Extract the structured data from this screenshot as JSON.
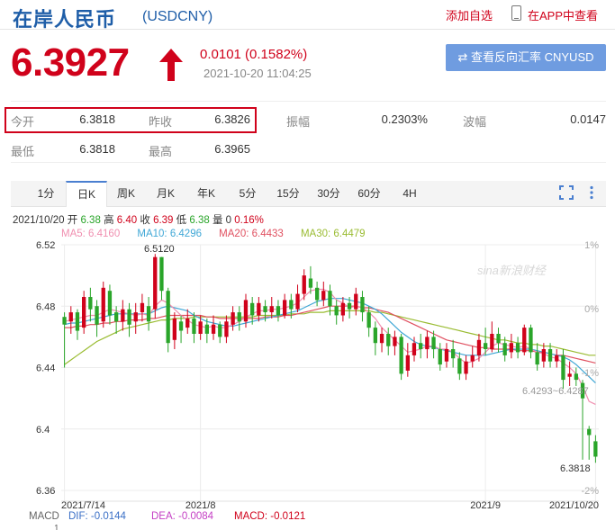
{
  "header": {
    "title": "在岸人民币",
    "code": "(USDCNY)",
    "watchlist_label": "添加自选",
    "app_label": "在APP中查看"
  },
  "quote": {
    "price": "6.3927",
    "change": "0.0101 (0.1582%)",
    "time": "2021-10-20 11:04:25",
    "reverse_button": "查看反向汇率 CNYUSD"
  },
  "stats": [
    {
      "label": "今开",
      "value": "6.3818"
    },
    {
      "label": "昨收",
      "value": "6.3826"
    },
    {
      "label": "振幅",
      "value": "0.2303%"
    },
    {
      "label": "波幅",
      "value": "0.0147"
    },
    {
      "label": "最低",
      "value": "6.3818"
    },
    {
      "label": "最高",
      "value": "6.3965"
    }
  ],
  "tabs": [
    "1分",
    "日K",
    "周K",
    "月K",
    "年K",
    "5分",
    "15分",
    "30分",
    "60分",
    "4H"
  ],
  "active_tab": "日K",
  "ohlc": {
    "date": "2021/10/20",
    "open_label": "开",
    "open": "6.38",
    "high_label": "高",
    "high": "6.40",
    "close_label": "收",
    "close": "6.39",
    "low_label": "低",
    "low": "6.38",
    "vol_label": "量",
    "vol": "0",
    "pct": "0.16%"
  },
  "ma_legend": {
    "ma5": "MA5: 6.4160",
    "ma10": "MA10: 6.4296",
    "ma20": "MA20: 6.4433",
    "ma30": "MA30: 6.4479"
  },
  "macd_legend": {
    "label": "MACD",
    "dif": "DIF: -0.0144",
    "dea": "DEA: -0.0084",
    "macd": "MACD: -0.0121",
    "axis_value": "1"
  },
  "watermark": "sina新浪财经",
  "colors": {
    "up": "#d0021b",
    "down": "#2aa52a",
    "accent": "#1f5ea8",
    "ma5": "#f08fb0",
    "ma10": "#3fa7d6",
    "ma20": "#e05060",
    "ma30": "#9abc32"
  },
  "chart_data": {
    "type": "candlestick",
    "ylim": [
      6.36,
      6.52
    ],
    "y_ticks": [
      "6.52",
      "6.48",
      "6.44",
      "6.4",
      "6.36"
    ],
    "pct_ticks": [
      "1%",
      "0%",
      "-1%",
      "-2%"
    ],
    "x_ticks": [
      "2021/7/14",
      "2021/8",
      "2021/9",
      "2021/10/20"
    ],
    "annotations": {
      "high": "6.5120",
      "range": "6.4293~6.4287",
      "last": "6.3818"
    },
    "candles": [
      [
        6.473,
        6.468,
        6.476,
        6.44
      ],
      [
        6.47,
        6.476,
        6.48,
        6.462
      ],
      [
        6.476,
        6.464,
        6.478,
        6.458
      ],
      [
        6.466,
        6.486,
        6.49,
        6.462
      ],
      [
        6.486,
        6.478,
        6.492,
        6.47
      ],
      [
        6.48,
        6.468,
        6.484,
        6.46
      ],
      [
        6.47,
        6.492,
        6.496,
        6.466
      ],
      [
        6.49,
        6.474,
        6.494,
        6.468
      ],
      [
        6.476,
        6.47,
        6.48,
        6.462
      ],
      [
        6.47,
        6.478,
        6.484,
        6.464
      ],
      [
        6.478,
        6.468,
        6.482,
        6.46
      ],
      [
        6.47,
        6.476,
        6.482,
        6.462
      ],
      [
        6.476,
        6.482,
        6.488,
        6.47
      ],
      [
        6.48,
        6.47,
        6.486,
        6.464
      ],
      [
        6.478,
        6.512,
        6.514,
        6.472
      ],
      [
        6.512,
        6.49,
        6.512,
        6.484
      ],
      [
        6.49,
        6.456,
        6.492,
        6.45
      ],
      [
        6.458,
        6.472,
        6.476,
        6.452
      ],
      [
        6.47,
        6.464,
        6.474,
        6.456
      ],
      [
        6.466,
        6.472,
        6.478,
        6.462
      ],
      [
        6.472,
        6.462,
        6.476,
        6.456
      ],
      [
        6.462,
        6.47,
        6.474,
        6.458
      ],
      [
        6.468,
        6.462,
        6.472,
        6.456
      ],
      [
        6.462,
        6.468,
        6.474,
        6.458
      ],
      [
        6.468,
        6.46,
        6.47,
        6.456
      ],
      [
        6.46,
        6.47,
        6.474,
        6.456
      ],
      [
        6.468,
        6.476,
        6.48,
        6.464
      ],
      [
        6.476,
        6.47,
        6.48,
        6.464
      ],
      [
        6.47,
        6.484,
        6.488,
        6.466
      ],
      [
        6.482,
        6.474,
        6.486,
        6.468
      ],
      [
        6.474,
        6.482,
        6.486,
        6.47
      ],
      [
        6.48,
        6.476,
        6.484,
        6.47
      ],
      [
        6.476,
        6.48,
        6.486,
        6.472
      ],
      [
        6.48,
        6.474,
        6.484,
        6.47
      ],
      [
        6.474,
        6.484,
        6.488,
        6.472
      ],
      [
        6.484,
        6.478,
        6.488,
        6.472
      ],
      [
        6.478,
        6.488,
        6.494,
        6.476
      ],
      [
        6.488,
        6.5,
        6.504,
        6.484
      ],
      [
        6.498,
        6.492,
        6.506,
        6.488
      ],
      [
        6.492,
        6.484,
        6.496,
        6.48
      ],
      [
        6.484,
        6.49,
        6.496,
        6.48
      ],
      [
        6.49,
        6.48,
        6.494,
        6.474
      ],
      [
        6.48,
        6.474,
        6.484,
        6.468
      ],
      [
        6.474,
        6.482,
        6.486,
        6.47
      ],
      [
        6.482,
        6.478,
        6.486,
        6.472
      ],
      [
        6.478,
        6.488,
        6.492,
        6.474
      ],
      [
        6.486,
        6.476,
        6.49,
        6.47
      ],
      [
        6.476,
        6.466,
        6.48,
        6.46
      ],
      [
        6.466,
        6.456,
        6.47,
        6.448
      ],
      [
        6.456,
        6.462,
        6.466,
        6.45
      ],
      [
        6.462,
        6.454,
        6.466,
        6.448
      ],
      [
        6.454,
        6.46,
        6.464,
        6.448
      ],
      [
        6.46,
        6.436,
        6.462,
        6.432
      ],
      [
        6.438,
        6.448,
        6.456,
        6.434
      ],
      [
        6.448,
        6.456,
        6.46,
        6.444
      ],
      [
        6.456,
        6.452,
        6.462,
        6.446
      ],
      [
        6.452,
        6.46,
        6.464,
        6.446
      ],
      [
        6.46,
        6.452,
        6.464,
        6.446
      ],
      [
        6.452,
        6.442,
        6.456,
        6.438
      ],
      [
        6.444,
        6.452,
        6.456,
        6.44
      ],
      [
        6.452,
        6.446,
        6.458,
        6.44
      ],
      [
        6.446,
        6.436,
        6.45,
        6.432
      ],
      [
        6.436,
        6.444,
        6.448,
        6.432
      ],
      [
        6.444,
        6.448,
        6.454,
        6.44
      ],
      [
        6.448,
        6.458,
        6.462,
        6.444
      ],
      [
        6.456,
        6.452,
        6.466,
        6.448
      ],
      [
        6.452,
        6.462,
        6.47,
        6.45
      ],
      [
        6.462,
        6.456,
        6.466,
        6.45
      ],
      [
        6.456,
        6.448,
        6.46,
        6.444
      ],
      [
        6.45,
        6.456,
        6.462,
        6.446
      ],
      [
        6.456,
        6.45,
        6.46,
        6.446
      ],
      [
        6.45,
        6.466,
        6.468,
        6.448
      ],
      [
        6.466,
        6.45,
        6.468,
        6.446
      ],
      [
        6.45,
        6.442,
        6.456,
        6.438
      ],
      [
        6.444,
        6.452,
        6.456,
        6.44
      ],
      [
        6.452,
        6.444,
        6.456,
        6.44
      ],
      [
        6.444,
        6.448,
        6.452,
        6.44
      ],
      [
        6.448,
        6.432,
        6.452,
        6.426
      ],
      [
        6.434,
        6.436,
        6.444,
        6.428
      ],
      [
        6.436,
        6.432,
        6.44,
        6.428
      ],
      [
        6.43,
        6.42,
        6.432,
        6.38
      ],
      [
        6.4,
        6.396,
        6.402,
        6.38
      ],
      [
        6.392,
        6.382,
        6.396,
        6.378
      ]
    ],
    "ma5": [
      6.47,
      6.471,
      6.472,
      6.473,
      6.474,
      6.474,
      6.476,
      6.478,
      6.477,
      6.476,
      6.475,
      6.474,
      6.475,
      6.474,
      6.48,
      6.484,
      6.482,
      6.478,
      6.474,
      6.471,
      6.468,
      6.467,
      6.466,
      6.467,
      6.466,
      6.466,
      6.468,
      6.47,
      6.473,
      6.475,
      6.477,
      6.477,
      6.478,
      6.478,
      6.479,
      6.48,
      6.482,
      6.486,
      6.49,
      6.491,
      6.491,
      6.489,
      6.484,
      6.482,
      6.479,
      6.48,
      6.479,
      6.476,
      6.472,
      6.466,
      6.462,
      6.458,
      6.454,
      6.45,
      6.451,
      6.452,
      6.454,
      6.454,
      6.452,
      6.452,
      6.45,
      6.446,
      6.443,
      6.444,
      6.446,
      6.45,
      6.454,
      6.456,
      6.455,
      6.454,
      6.453,
      6.454,
      6.452,
      6.45,
      6.449,
      6.447,
      6.446,
      6.443,
      6.44,
      6.436,
      6.428,
      6.418,
      6.416
    ],
    "ma10": [
      6.468,
      6.469,
      6.469,
      6.47,
      6.471,
      6.472,
      6.473,
      6.474,
      6.475,
      6.475,
      6.475,
      6.475,
      6.475,
      6.475,
      6.477,
      6.479,
      6.48,
      6.479,
      6.478,
      6.477,
      6.474,
      6.472,
      6.47,
      6.469,
      6.468,
      6.467,
      6.467,
      6.468,
      6.469,
      6.47,
      6.471,
      6.472,
      6.473,
      6.474,
      6.475,
      6.476,
      6.477,
      6.479,
      6.481,
      6.483,
      6.484,
      6.485,
      6.485,
      6.485,
      6.484,
      6.483,
      6.482,
      6.48,
      6.478,
      6.475,
      6.471,
      6.467,
      6.463,
      6.46,
      6.457,
      6.455,
      6.454,
      6.453,
      6.452,
      6.451,
      6.45,
      6.449,
      6.448,
      6.448,
      6.448,
      6.448,
      6.449,
      6.45,
      6.451,
      6.452,
      6.452,
      6.452,
      6.452,
      6.451,
      6.45,
      6.449,
      6.448,
      6.447,
      6.445,
      6.442,
      6.438,
      6.434,
      6.43
    ],
    "ma20": [
      6.466,
      6.466,
      6.467,
      6.467,
      6.468,
      6.468,
      6.469,
      6.469,
      6.47,
      6.47,
      6.471,
      6.471,
      6.471,
      6.472,
      6.472,
      6.473,
      6.474,
      6.474,
      6.474,
      6.474,
      6.474,
      6.474,
      6.473,
      6.473,
      6.472,
      6.472,
      6.472,
      6.472,
      6.472,
      6.472,
      6.472,
      6.473,
      6.473,
      6.473,
      6.474,
      6.474,
      6.475,
      6.476,
      6.477,
      6.478,
      6.479,
      6.48,
      6.48,
      6.48,
      6.48,
      6.48,
      6.479,
      6.479,
      6.478,
      6.477,
      6.476,
      6.474,
      6.472,
      6.47,
      6.468,
      6.466,
      6.464,
      6.462,
      6.46,
      6.458,
      6.457,
      6.456,
      6.455,
      6.454,
      6.453,
      6.453,
      6.452,
      6.452,
      6.452,
      6.452,
      6.451,
      6.451,
      6.451,
      6.45,
      6.45,
      6.449,
      6.448,
      6.448,
      6.447,
      6.446,
      6.445,
      6.444,
      6.443
    ],
    "ma30": [
      6.442,
      6.445,
      6.448,
      6.451,
      6.454,
      6.457,
      6.459,
      6.461,
      6.463,
      6.465,
      6.466,
      6.467,
      6.468,
      6.469,
      6.47,
      6.471,
      6.471,
      6.472,
      6.472,
      6.472,
      6.473,
      6.473,
      6.473,
      6.473,
      6.473,
      6.473,
      6.473,
      6.473,
      6.473,
      6.473,
      6.474,
      6.474,
      6.474,
      6.474,
      6.474,
      6.475,
      6.475,
      6.475,
      6.476,
      6.476,
      6.476,
      6.477,
      6.477,
      6.477,
      6.477,
      6.477,
      6.477,
      6.477,
      6.476,
      6.476,
      6.475,
      6.474,
      6.473,
      6.472,
      6.471,
      6.47,
      6.469,
      6.468,
      6.467,
      6.466,
      6.465,
      6.464,
      6.463,
      6.462,
      6.461,
      6.46,
      6.459,
      6.458,
      6.458,
      6.457,
      6.456,
      6.456,
      6.455,
      6.455,
      6.454,
      6.454,
      6.453,
      6.452,
      6.451,
      6.45,
      6.449,
      6.448,
      6.448
    ]
  }
}
